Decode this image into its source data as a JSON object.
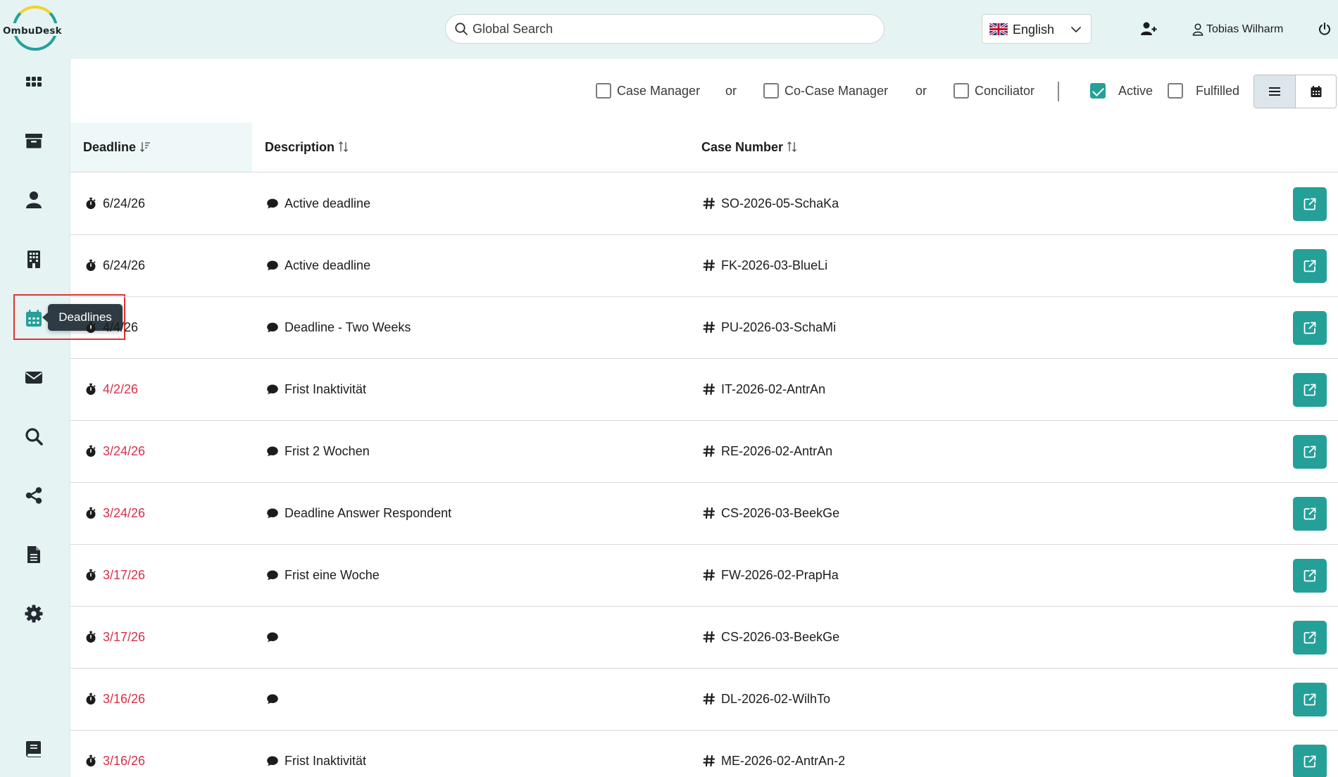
{
  "app": {
    "logo_text": "OmbuDesk"
  },
  "header": {
    "search_placeholder": "Global Search",
    "language": "English",
    "user_name": "Tobias Wilharm"
  },
  "sidebar": {
    "items": [
      {
        "name": "dashboard",
        "icon": "grid-icon"
      },
      {
        "name": "archive",
        "icon": "archive-icon"
      },
      {
        "name": "persons",
        "icon": "person-icon"
      },
      {
        "name": "organizations",
        "icon": "building-icon"
      },
      {
        "name": "deadlines",
        "icon": "calendar-icon",
        "active": true
      },
      {
        "name": "messages",
        "icon": "envelope-icon"
      },
      {
        "name": "search",
        "icon": "search-icon"
      },
      {
        "name": "share",
        "icon": "share-icon"
      },
      {
        "name": "documents",
        "icon": "document-icon"
      },
      {
        "name": "settings",
        "icon": "gear-icon"
      },
      {
        "name": "handbook",
        "icon": "book-icon"
      }
    ],
    "tooltip": "Deadlines"
  },
  "filters": {
    "case_manager": {
      "label": "Case Manager",
      "checked": false
    },
    "or1": "or",
    "co_case_manager": {
      "label": "Co-Case Manager",
      "checked": false
    },
    "or2": "or",
    "conciliator": {
      "label": "Conciliator",
      "checked": false
    },
    "active": {
      "label": "Active",
      "checked": true
    },
    "fulfilled": {
      "label": "Fulfilled",
      "checked": false
    },
    "view": "list"
  },
  "table": {
    "columns": {
      "deadline": "Deadline",
      "description": "Description",
      "case_number": "Case Number"
    },
    "rows": [
      {
        "deadline": "6/24/26",
        "overdue": false,
        "description": "Active deadline",
        "case_number": "SO-2026-05-SchaKa"
      },
      {
        "deadline": "6/24/26",
        "overdue": false,
        "description": "Active deadline",
        "case_number": "FK-2026-03-BlueLi"
      },
      {
        "deadline": "4/4/26",
        "overdue": false,
        "description": "Deadline - Two Weeks",
        "case_number": "PU-2026-03-SchaMi"
      },
      {
        "deadline": "4/2/26",
        "overdue": true,
        "description": "Frist Inaktivität",
        "case_number": "IT-2026-02-AntrAn"
      },
      {
        "deadline": "3/24/26",
        "overdue": true,
        "description": "Frist 2 Wochen",
        "case_number": "RE-2026-02-AntrAn"
      },
      {
        "deadline": "3/24/26",
        "overdue": true,
        "description": "Deadline Answer Respondent",
        "case_number": "CS-2026-03-BeekGe"
      },
      {
        "deadline": "3/17/26",
        "overdue": true,
        "description": "Frist eine Woche",
        "case_number": "FW-2026-02-PrapHa"
      },
      {
        "deadline": "3/17/26",
        "overdue": true,
        "description": "",
        "case_number": "CS-2026-03-BeekGe"
      },
      {
        "deadline": "3/16/26",
        "overdue": true,
        "description": "",
        "case_number": "DL-2026-02-WilhTo"
      },
      {
        "deadline": "3/16/26",
        "overdue": true,
        "description": "Frist Inaktivität",
        "case_number": "ME-2026-02-AntrAn-2"
      }
    ]
  },
  "colors": {
    "accent": "#24a098",
    "sidebar_bg": "#e5f3f3",
    "overdue": "#d6304a",
    "highlight_box": "#e4332d"
  }
}
